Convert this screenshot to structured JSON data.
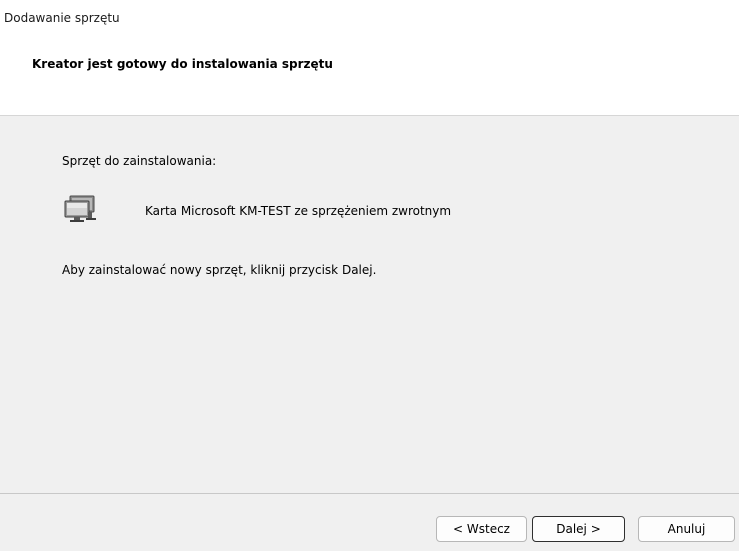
{
  "window": {
    "title": "Dodawanie sprzętu"
  },
  "header": {
    "title": "Kreator jest gotowy do instalowania sprzętu"
  },
  "content": {
    "section_label": "Sprzęt do zainstalowania:",
    "device": {
      "name": "Karta Microsoft KM-TEST ze sprzężeniem zwrotnym",
      "icon": "network-adapter-icon"
    },
    "instruction": "Aby zainstalować nowy sprzęt, kliknij przycisk Dalej."
  },
  "buttons": {
    "back_label": "< Wstecz",
    "next_label": "Dalej >",
    "cancel_label": "Anuluj"
  }
}
